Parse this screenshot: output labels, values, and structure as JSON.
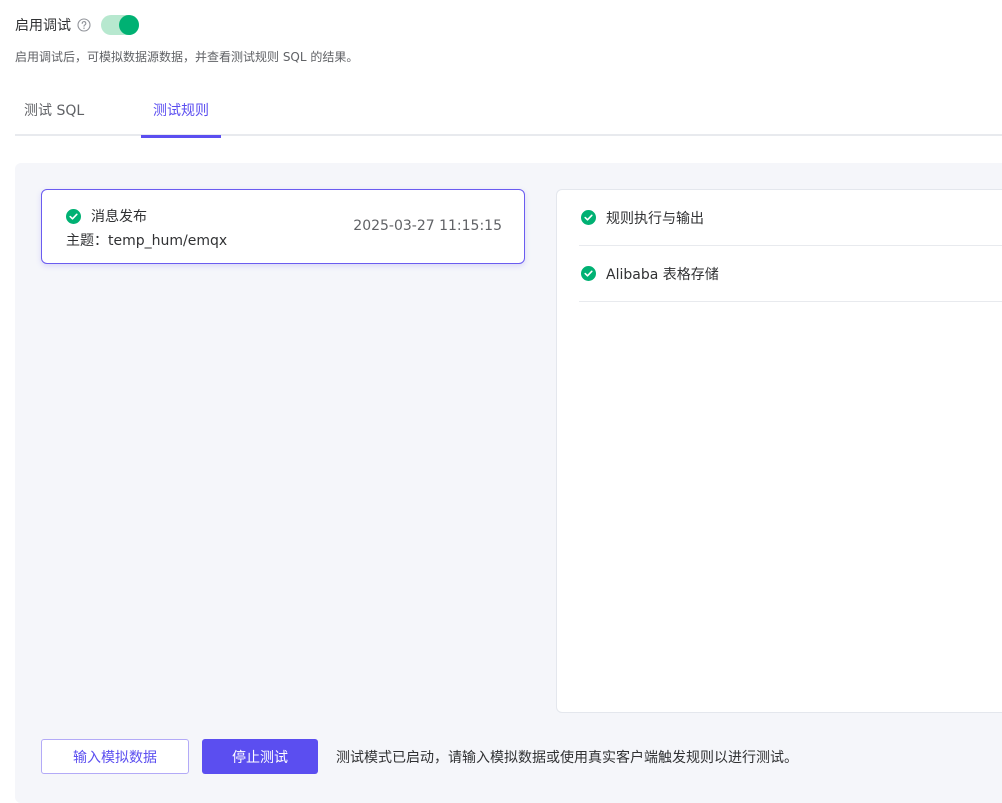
{
  "debug": {
    "label": "启用调试",
    "enabled": true,
    "description": "启用调试后，可模拟数据源数据，并查看测试规则 SQL 的结果。"
  },
  "tabs": [
    {
      "label": "测试 SQL",
      "active": false
    },
    {
      "label": "测试规则",
      "active": true
    }
  ],
  "event": {
    "name": "消息发布",
    "topic": "主题：temp_hum/emqx",
    "time": "2025-03-27 11:15:15"
  },
  "results": [
    {
      "label": "规则执行与输出"
    },
    {
      "label": "Alibaba 表格存储"
    }
  ],
  "actions": {
    "input_mock": "输入模拟数据",
    "stop_test": "停止测试",
    "status": "测试模式已启动，请输入模拟数据或使用真实客户端触发规则以进行测试。"
  },
  "colors": {
    "accent": "#5b4ef0",
    "success": "#00b173"
  }
}
